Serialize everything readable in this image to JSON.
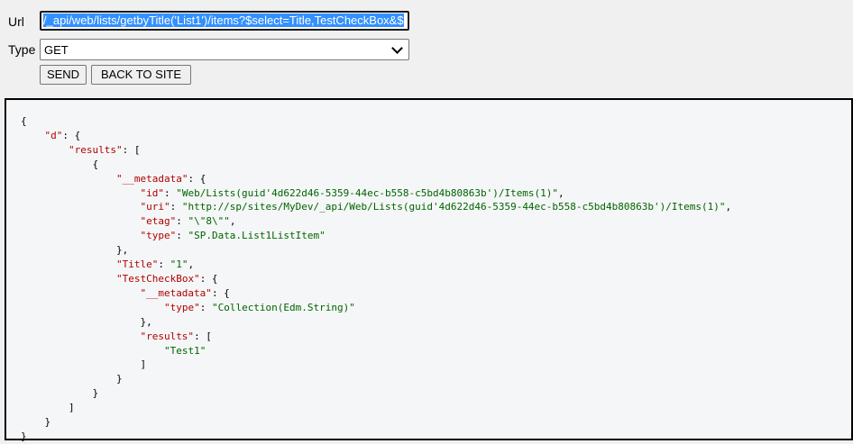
{
  "form": {
    "url_label": "Url",
    "url_value": "/_api/web/lists/getbyTitle('List1')/items?$select=Title,TestCheckBox&$",
    "type_label": "Type",
    "type_selected": "GET"
  },
  "buttons": {
    "send_label": "SEND",
    "back_label": "BACK TO SITE"
  },
  "response": {
    "d_key": "\"d\"",
    "results_key": "\"results\"",
    "metadata_key": "\"__metadata\"",
    "id_key": "\"id\"",
    "id_value": "\"Web/Lists(guid'4d622d46-5359-44ec-b558-c5bd4b80863b')/Items(1)\"",
    "uri_key": "\"uri\"",
    "uri_value": "\"http://sp/sites/MyDev/_api/Web/Lists(guid'4d622d46-5359-44ec-b558-c5bd4b80863b')/Items(1)\"",
    "etag_key": "\"etag\"",
    "etag_value": "\"\\\"8\\\"\"",
    "type_key": "\"type\"",
    "type_value": "\"SP.Data.List1ListItem\"",
    "title_key": "\"Title\"",
    "title_value": "\"1\"",
    "checkbox_key": "\"TestCheckBox\"",
    "checkbox_meta_key": "\"__metadata\"",
    "checkbox_type_key": "\"type\"",
    "checkbox_type_value": "\"Collection(Edm.String)\"",
    "checkbox_results_key": "\"results\"",
    "checkbox_result_item": "\"Test1\""
  }
}
